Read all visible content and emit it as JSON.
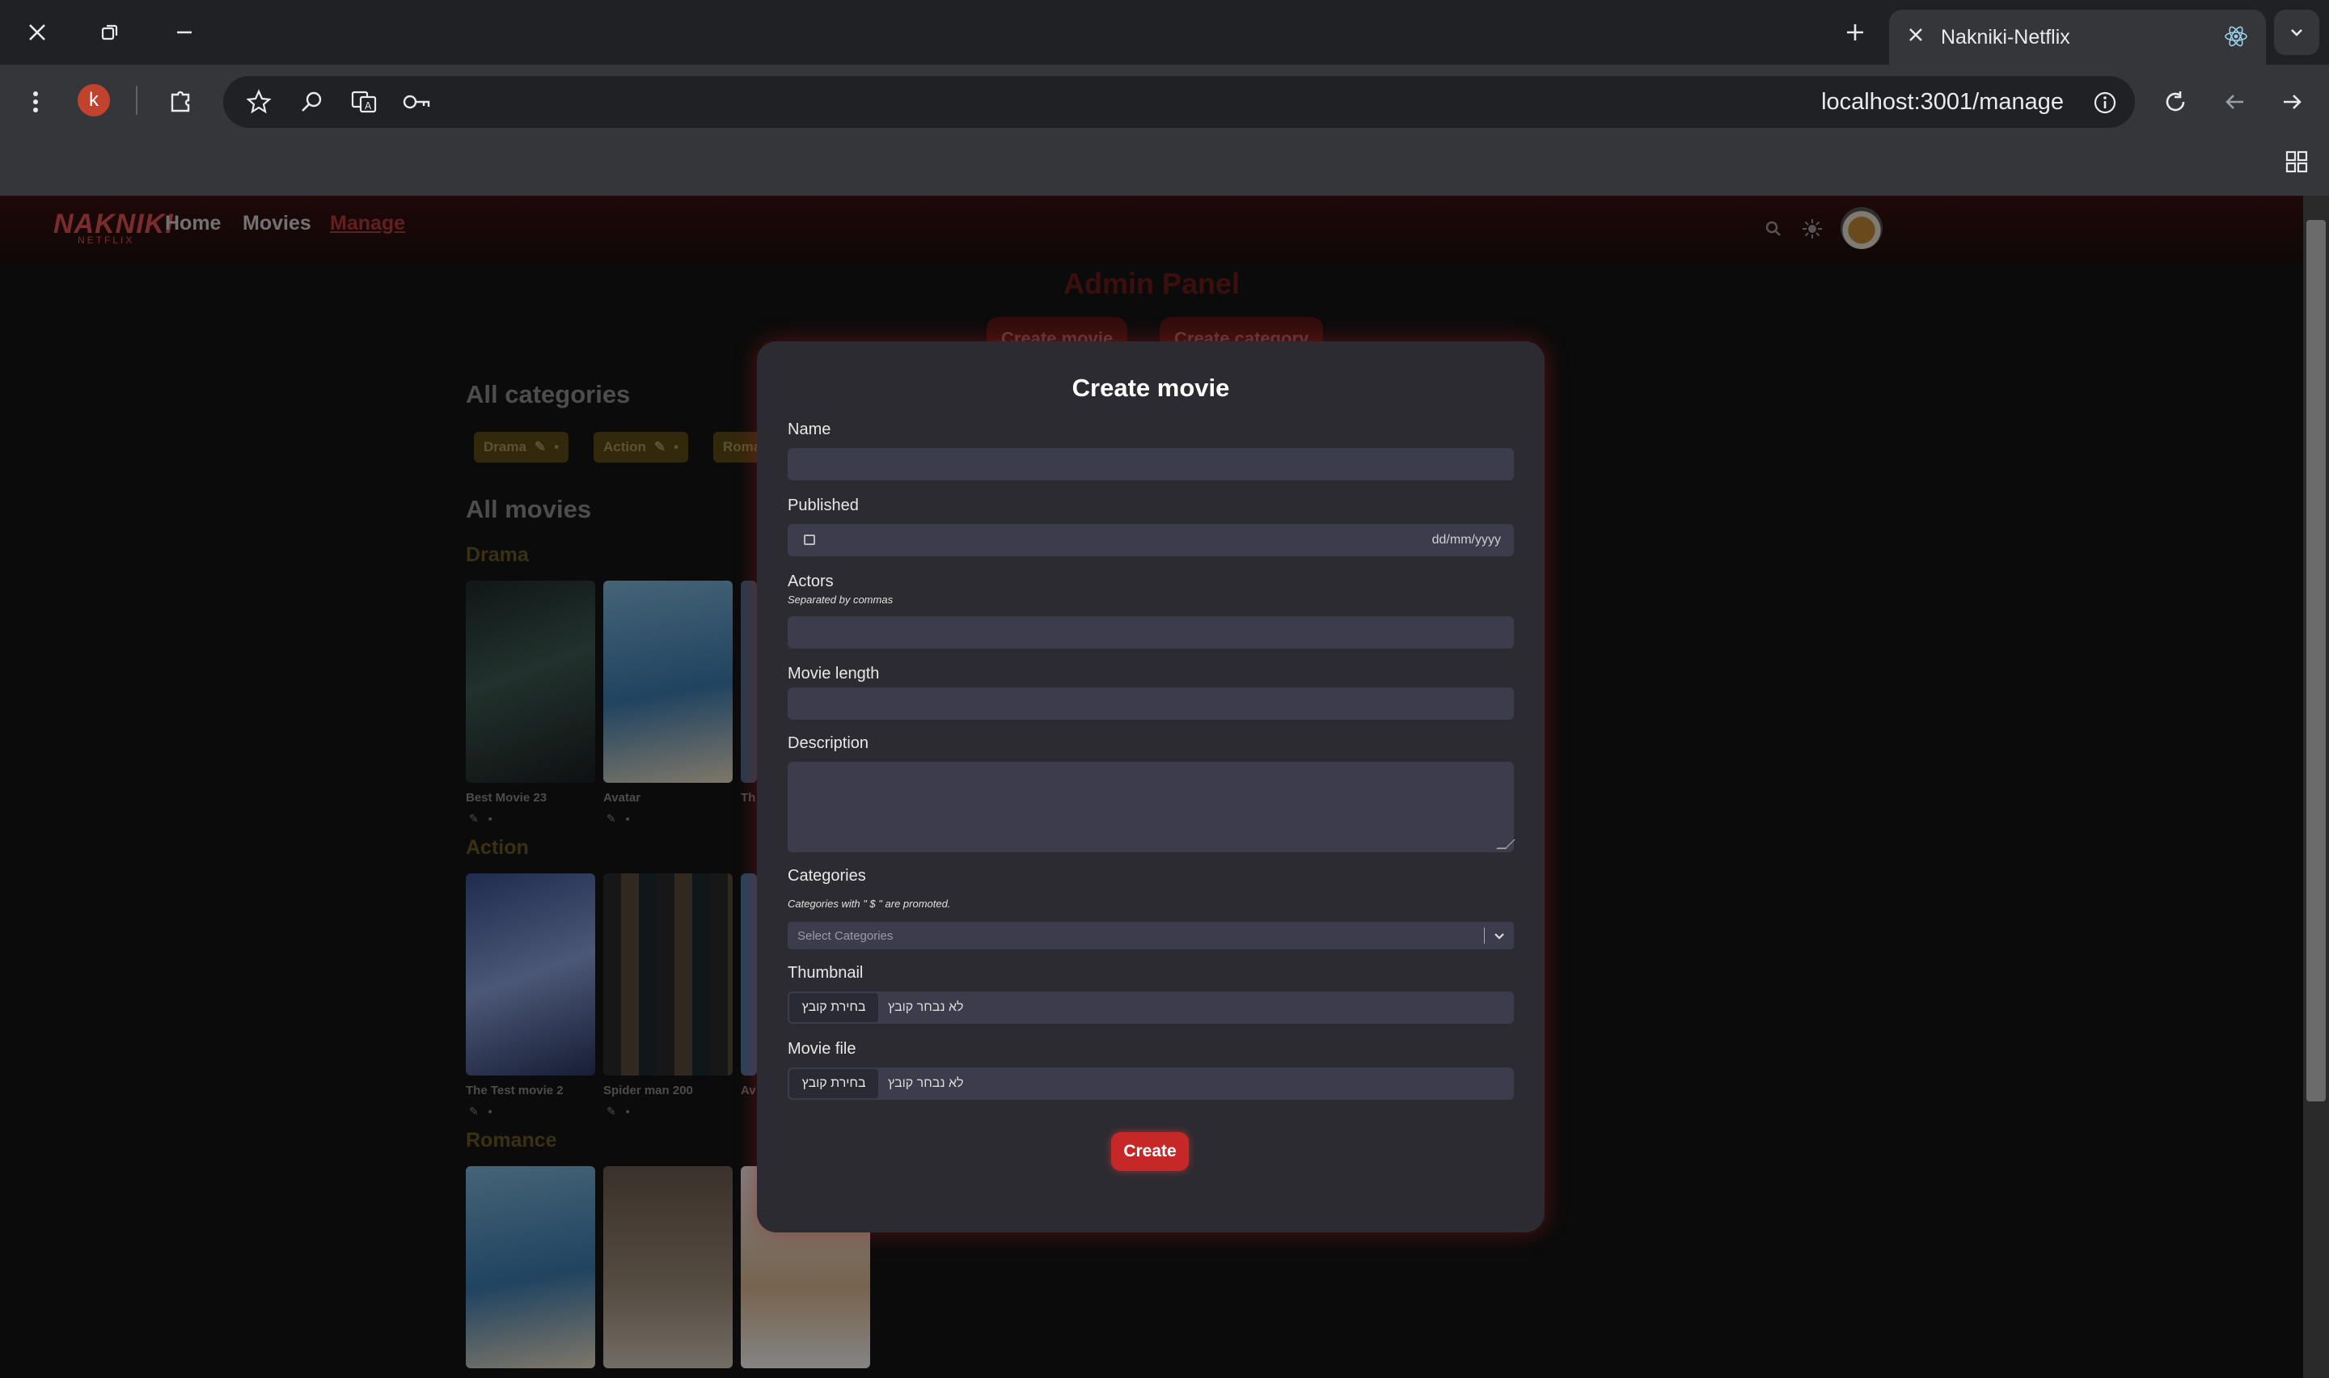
{
  "browser": {
    "tab_title": "Nakniki-Netflix",
    "url": "localhost:3001/manage",
    "profile_initial": "k"
  },
  "nav": {
    "logo": "NAKNIKI",
    "logo_sub": "NETFLIX",
    "links": [
      "Home",
      "Movies",
      "Manage"
    ],
    "active_link": "Manage"
  },
  "admin": {
    "title": "Admin Panel",
    "create_movie_btn": "Create movie",
    "create_category_btn": "Create category",
    "all_categories": "All categories",
    "categories": [
      "Drama",
      "Action",
      "Roma"
    ],
    "all_movies": "All movies"
  },
  "movie_sections": [
    {
      "category": "Drama",
      "movies": [
        "Best Movie 23",
        "Avatar",
        "Th"
      ]
    },
    {
      "category": "Action",
      "movies": [
        "The Test movie 2",
        "Spider man 200",
        "Av"
      ]
    },
    {
      "category": "Romance",
      "movies": [
        "",
        "",
        ""
      ]
    }
  ],
  "modal": {
    "title": "Create movie",
    "name_label": "Name",
    "published_label": "Published",
    "date_placeholder": "dd/mm/yyyy",
    "actors_label": "Actors",
    "actors_hint": "Separated by commas",
    "length_label": "Movie length",
    "description_label": "Description",
    "categories_label": "Categories",
    "categories_hint": "Categories with \" $ \" are promoted.",
    "categories_placeholder": "Select Categories",
    "thumbnail_label": "Thumbnail",
    "moviefile_label": "Movie file",
    "file_button": "בחירת קובץ",
    "file_status": "לא נבחר קובץ",
    "create_button": "Create"
  },
  "colors": {
    "accent": "#c62828",
    "chip": "#5c4a15",
    "modal_bg": "#2b2b31",
    "input_bg": "#3c3c4d"
  }
}
